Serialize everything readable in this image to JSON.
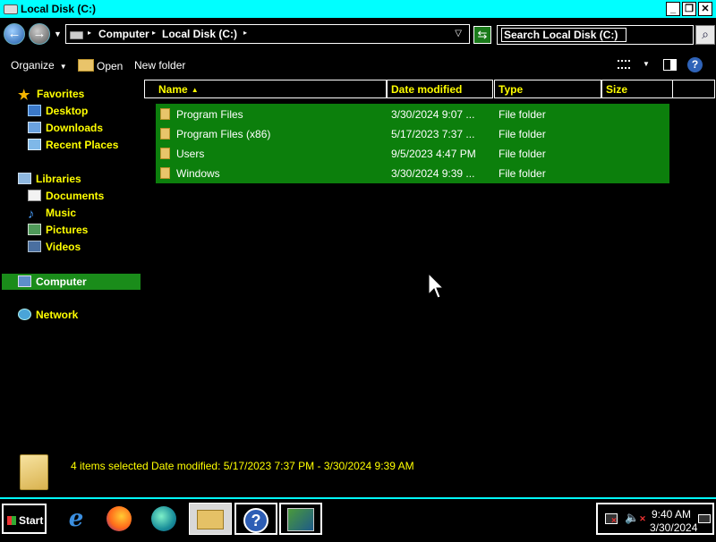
{
  "window": {
    "title": "Local Disk (C:)"
  },
  "addressbar": {
    "crumbs": [
      "Computer",
      "Local Disk (C:)"
    ],
    "search_placeholder": "Search Local Disk (C:)"
  },
  "toolbar": {
    "organize": "Organize",
    "open": "Open",
    "new_folder": "New folder"
  },
  "nav": {
    "favorites": "Favorites",
    "desktop": "Desktop",
    "downloads": "Downloads",
    "recent": "Recent Places",
    "libraries": "Libraries",
    "documents": "Documents",
    "music": "Music",
    "pictures": "Pictures",
    "videos": "Videos",
    "computer": "Computer",
    "network": "Network"
  },
  "columns": {
    "name": "Name",
    "date": "Date modified",
    "type": "Type",
    "size": "Size"
  },
  "files": [
    {
      "name": "Program Files",
      "date": "3/30/2024 9:07 ...",
      "type": "File folder"
    },
    {
      "name": "Program Files (x86)",
      "date": "5/17/2023 7:37 ...",
      "type": "File folder"
    },
    {
      "name": "Users",
      "date": "9/5/2023 4:47 PM",
      "type": "File folder"
    },
    {
      "name": "Windows",
      "date": "3/30/2024 9:39 ...",
      "type": "File folder"
    }
  ],
  "details": {
    "text": "4 items selected  Date modified: 5/17/2023 7:37 PM - 3/30/2024 9:39 AM"
  },
  "taskbar": {
    "start": "Start",
    "time": "9:40 AM",
    "date": "3/30/2024",
    "apps": [
      "internet-explorer",
      "firefox",
      "edge",
      "file-explorer",
      "help",
      "remote-desktop"
    ]
  },
  "colors": {
    "titlebar": "#00ffff",
    "selection": "#0c7f0c",
    "nav_text": "#ffff00"
  }
}
